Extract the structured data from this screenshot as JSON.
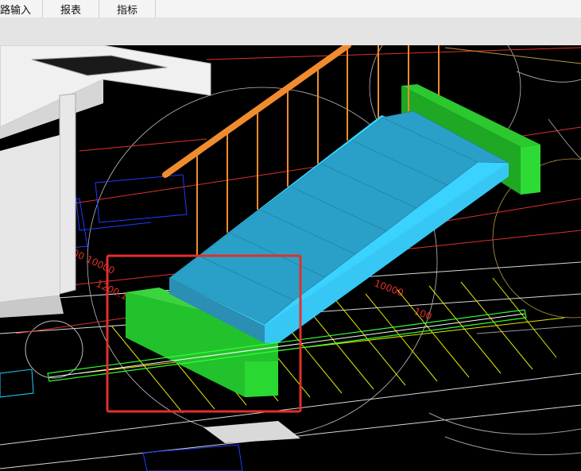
{
  "menu": {
    "items": [
      {
        "label": "路输入"
      },
      {
        "label": "报表"
      },
      {
        "label": "指标"
      }
    ]
  },
  "viewport": {
    "scene": "3d-staircase-model",
    "colors": {
      "background": "#000000",
      "stair": "#35c9f0",
      "stair_shade": "#2a8fb2",
      "landing_block": "#22c22c",
      "railing": "#f08c2e",
      "selection_box": "#e0302a",
      "slab": "#ffffff"
    }
  }
}
